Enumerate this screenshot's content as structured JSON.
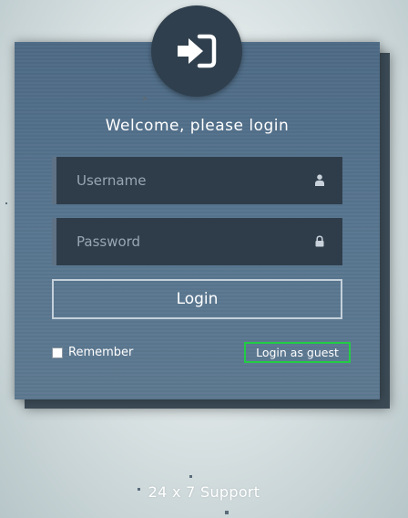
{
  "login": {
    "title": "Welcome, please login",
    "username_placeholder": "Username",
    "password_placeholder": "Password",
    "login_button": "Login",
    "remember_label": "Remember",
    "guest_link": "Login as guest"
  },
  "footer": {
    "support_text": "24 x 7 Support"
  },
  "icons": {
    "badge": "sign-in-icon",
    "username": "user-icon",
    "password": "lock-icon"
  },
  "colors": {
    "card": "#587690",
    "badge": "#2f3f4d",
    "field": "#2f3d4b",
    "guest_highlight": "#22cc44"
  }
}
